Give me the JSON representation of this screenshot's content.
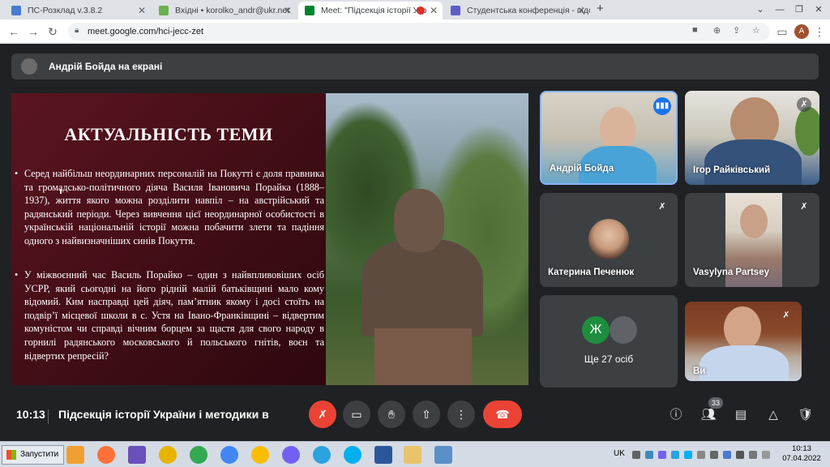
{
  "browser": {
    "tabs": [
      {
        "title": "ПС-Розклад v.3.8.2"
      },
      {
        "title": "Вхідні • korolko_andr@ukr.net"
      },
      {
        "title": "Meet: \"Підсекція історії Укр"
      },
      {
        "title": "Студентська конференція - підс"
      }
    ],
    "new_tab": "+",
    "url": "meet.google.com/hci-jecc-zet",
    "profile_initial": "A"
  },
  "banner": {
    "presenter_text": "Андрій Бойда на екрані"
  },
  "slide": {
    "title": "АКТУАЛЬНІСТЬ ТЕМИ",
    "bullets": [
      "Серед найбільш неординарних персоналій на Покутті є доля правника та громадсько-політичного діяча Василя Івановича Порайка (1888–1937), життя якого можна розділити навпіл – на австрійський та радянський періоди. Через вивчення цієї неординарної особистості в українській національній історії можна побачити злети та падіння одного з найвизначніших синів Покуття.",
      "У міжвоєнний час Василь Порайко – один з найвпливовіших осіб УСРР, який сьогодні на його рідній малій батьківщині мало кому відомий. Ким насправді цей діяч, пам’ятник якому і досі стоїть на подвір’ї місцевої школи в с. Устя на Івано-Франківщині – відвертим комуністом чи справді вічним борцем за щастя для свого народу в горнилі радянського московського й польського гнітів, воєн та відвертих репресій?"
    ],
    "bullet_symbol": "•"
  },
  "participants": {
    "andriy": "Андрій Бойда",
    "ihor": "Ігор Райківський",
    "kateryna": "Катерина Печенюк",
    "vasylyna": "Vasylyna Partsey",
    "others_label": "Ще 27 осіб",
    "others_initial": "Ж",
    "you": "Ви"
  },
  "bottom": {
    "time": "10:13",
    "meeting_title": "Підсекція історії України і методики ви...",
    "participant_count": "33"
  },
  "taskbar": {
    "start_label": "Запустити",
    "lang": "UK",
    "time": "10:13",
    "date": "07.04.2022"
  },
  "colors": {
    "slide_bg": "#4a1018",
    "accent_red": "#ea4335",
    "speaking_blue": "#8ab4f8",
    "meet_bg": "#202124"
  }
}
